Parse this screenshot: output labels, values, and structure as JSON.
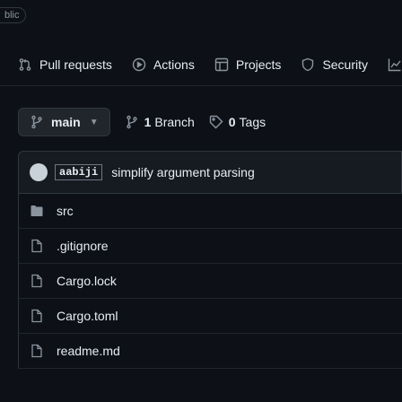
{
  "top_badge": "blic",
  "tabs": [
    {
      "label": "Pull requests",
      "icon": "pull-request-icon"
    },
    {
      "label": "Actions",
      "icon": "play-icon"
    },
    {
      "label": "Projects",
      "icon": "table-icon"
    },
    {
      "label": "Security",
      "icon": "shield-icon"
    }
  ],
  "branch": {
    "name": "main",
    "branch_count": "1",
    "branch_word": "Branch",
    "tag_count": "0",
    "tag_word": "Tags"
  },
  "commit": {
    "sha": "aabiji",
    "message": "simplify argument parsing"
  },
  "files": [
    {
      "name": "src",
      "type": "folder"
    },
    {
      "name": ".gitignore",
      "type": "file"
    },
    {
      "name": "Cargo.lock",
      "type": "file"
    },
    {
      "name": "Cargo.toml",
      "type": "file"
    },
    {
      "name": "readme.md",
      "type": "file"
    }
  ],
  "colors": {
    "background": "#0d1117",
    "folder": "#8b949e",
    "text": "#e6edf3"
  }
}
